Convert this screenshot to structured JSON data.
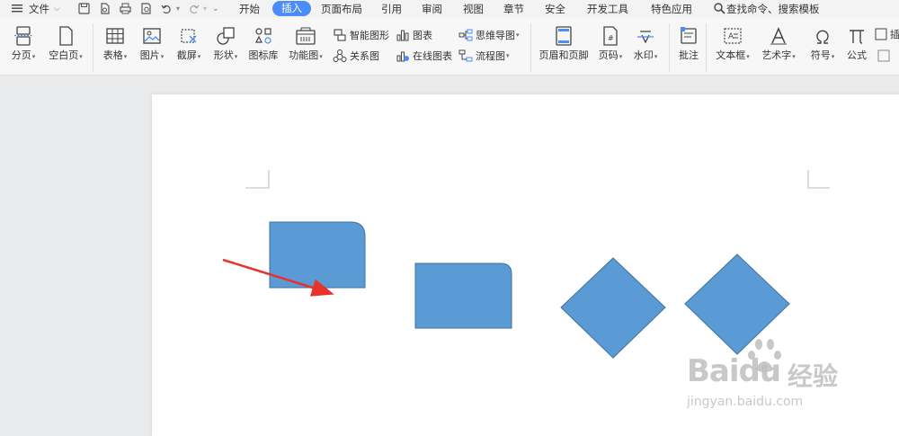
{
  "menubar": {
    "file_label": "文件",
    "tabs": [
      {
        "label": "开始"
      },
      {
        "label": "插入"
      },
      {
        "label": "页面布局"
      },
      {
        "label": "引用"
      },
      {
        "label": "审阅"
      },
      {
        "label": "视图"
      },
      {
        "label": "章节"
      },
      {
        "label": "安全"
      },
      {
        "label": "开发工具"
      },
      {
        "label": "特色应用"
      }
    ],
    "active_tab": "插入",
    "search_placeholder": "查找命令、搜索模板"
  },
  "ribbon": {
    "page_break": "分页",
    "blank_page": "空白页",
    "table": "表格",
    "picture": "图片",
    "screenshot": "截屏",
    "shape": "形状",
    "icon_library": "图标库",
    "function_chart": "功能图",
    "smart_graphic": "智能图形",
    "chart": "图表",
    "mind_map": "思维导图",
    "relation_chart": "关系图",
    "online_chart": "在线图表",
    "flowchart": "流程图",
    "header_footer": "页眉和页脚",
    "page_number": "页码",
    "watermark": "水印",
    "comment": "批注",
    "text_box": "文本框",
    "word_art": "艺术字",
    "symbol": "符号",
    "formula": "公式",
    "insert_partial": "插"
  },
  "colors": {
    "accent": "#4a8df8",
    "shape_fill": "#5b9bd5",
    "shape_stroke": "#41719c",
    "arrow": "#e8332a"
  },
  "watermark": {
    "brand": "Baidu",
    "brand_cn": "经验",
    "url": "jingyan.baidu.com"
  }
}
